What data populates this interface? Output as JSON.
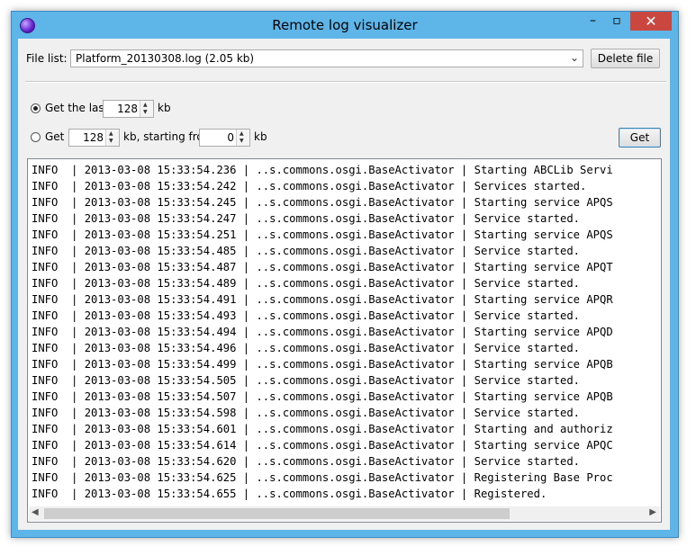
{
  "window": {
    "title": "Remote log visualizer"
  },
  "titlebar_buttons": {
    "minimize": "–",
    "maximize": "▫",
    "close": "✕"
  },
  "file_list": {
    "label": "File list:",
    "selected": "Platform_20130308.log (2.05 kb)"
  },
  "delete_button": "Delete file",
  "get_last": {
    "label": "Get the last",
    "value": "128",
    "unit": "kb",
    "checked": true
  },
  "get_range": {
    "label": "Get",
    "value": "128",
    "mid_label": "kb, starting from",
    "start": "0",
    "unit": "kb",
    "checked": false
  },
  "get_button": "Get",
  "log_lines": [
    "INFO  | 2013-03-08 15:33:54.236 | ..s.commons.osgi.BaseActivator | Starting ABCLib Servi",
    "INFO  | 2013-03-08 15:33:54.242 | ..s.commons.osgi.BaseActivator | Services started.",
    "INFO  | 2013-03-08 15:33:54.245 | ..s.commons.osgi.BaseActivator | Starting service APQS",
    "INFO  | 2013-03-08 15:33:54.247 | ..s.commons.osgi.BaseActivator | Service started.",
    "INFO  | 2013-03-08 15:33:54.251 | ..s.commons.osgi.BaseActivator | Starting service APQS",
    "INFO  | 2013-03-08 15:33:54.485 | ..s.commons.osgi.BaseActivator | Service started.",
    "INFO  | 2013-03-08 15:33:54.487 | ..s.commons.osgi.BaseActivator | Starting service APQT",
    "INFO  | 2013-03-08 15:33:54.489 | ..s.commons.osgi.BaseActivator | Service started.",
    "INFO  | 2013-03-08 15:33:54.491 | ..s.commons.osgi.BaseActivator | Starting service APQR",
    "INFO  | 2013-03-08 15:33:54.493 | ..s.commons.osgi.BaseActivator | Service started.",
    "INFO  | 2013-03-08 15:33:54.494 | ..s.commons.osgi.BaseActivator | Starting service APQD",
    "INFO  | 2013-03-08 15:33:54.496 | ..s.commons.osgi.BaseActivator | Service started.",
    "INFO  | 2013-03-08 15:33:54.499 | ..s.commons.osgi.BaseActivator | Starting service APQB",
    "INFO  | 2013-03-08 15:33:54.505 | ..s.commons.osgi.BaseActivator | Service started.",
    "INFO  | 2013-03-08 15:33:54.507 | ..s.commons.osgi.BaseActivator | Starting service APQB",
    "INFO  | 2013-03-08 15:33:54.598 | ..s.commons.osgi.BaseActivator | Service started.",
    "INFO  | 2013-03-08 15:33:54.601 | ..s.commons.osgi.BaseActivator | Starting and authoriz",
    "INFO  | 2013-03-08 15:33:54.614 | ..s.commons.osgi.BaseActivator | Starting service APQC",
    "INFO  | 2013-03-08 15:33:54.620 | ..s.commons.osgi.BaseActivator | Service started.",
    "INFO  | 2013-03-08 15:33:54.625 | ..s.commons.osgi.BaseActivator | Registering Base Proc",
    "INFO  | 2013-03-08 15:33:54.655 | ..s.commons.osgi.BaseActivator | Registered."
  ],
  "scrollbar": {
    "left": "◀",
    "right": "▶"
  },
  "spinner": {
    "up": "▲",
    "down": "▼"
  },
  "combo_arrow": "⌄"
}
